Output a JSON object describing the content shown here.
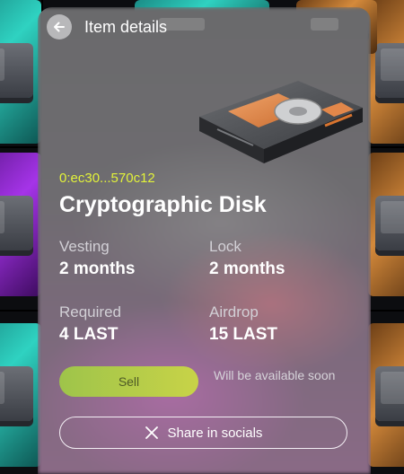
{
  "header": {
    "title": "Item details"
  },
  "item": {
    "token_id": "0:ec30...570c12",
    "name": "Cryptographic Disk"
  },
  "stats": {
    "vesting_label": "Vesting",
    "vesting_value": "2 months",
    "lock_label": "Lock",
    "lock_value": "2 months",
    "required_label": "Required",
    "required_value": "4 LAST",
    "airdrop_label": "Airdrop",
    "airdrop_value": "15 LAST"
  },
  "actions": {
    "sell_label": "Sell",
    "availability_note": "Will be available soon",
    "share_label": "Share in socials"
  },
  "icons": {
    "back": "arrow-left-icon",
    "share": "x-logo-icon"
  },
  "colors": {
    "token_id": "#e2f23a",
    "sell_button": "#b7cc47",
    "text": "#ffffff"
  }
}
